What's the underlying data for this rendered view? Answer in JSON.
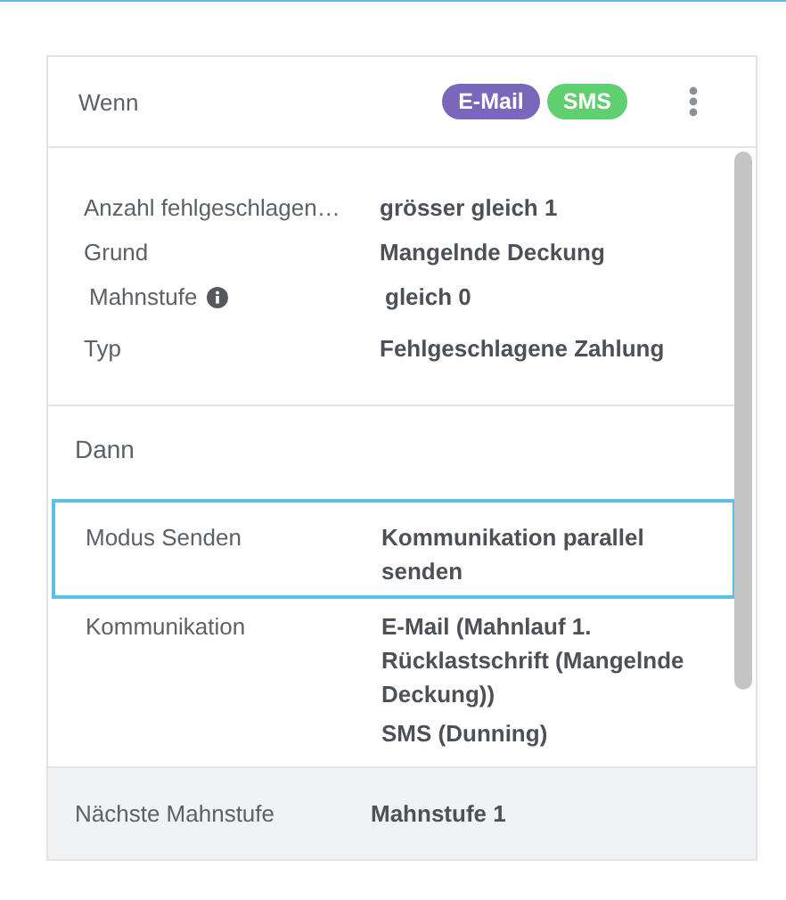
{
  "header": {
    "title": "Wenn",
    "tags": [
      {
        "label": "E-Mail",
        "color": "#7a67bb"
      },
      {
        "label": "SMS",
        "color": "#5fcf70"
      }
    ]
  },
  "conditions": [
    {
      "label": "Anzahl fehlgeschlagen…",
      "value": "grösser gleich 1",
      "info": false
    },
    {
      "label": "Grund",
      "value": "Mangelnde Deckung",
      "info": false
    },
    {
      "label": "Mahnstufe",
      "value": "gleich 0",
      "info": true
    },
    {
      "label": "Typ",
      "value": "Fehlgeschlagene Zahlung",
      "info": false
    }
  ],
  "then": {
    "title": "Dann",
    "rows": [
      {
        "label": "Modus Senden",
        "values": [
          "Kommunikation parallel senden"
        ],
        "selected": true
      },
      {
        "label": "Kommunikation",
        "values": [
          "E-Mail (Mahnlauf 1. Rücklastschrift (Mangelnde Deckung))",
          "SMS (Dunning)"
        ],
        "selected": false
      }
    ]
  },
  "footer": {
    "label": "Nächste Mahnstufe",
    "value": "Mahnstufe 1"
  }
}
